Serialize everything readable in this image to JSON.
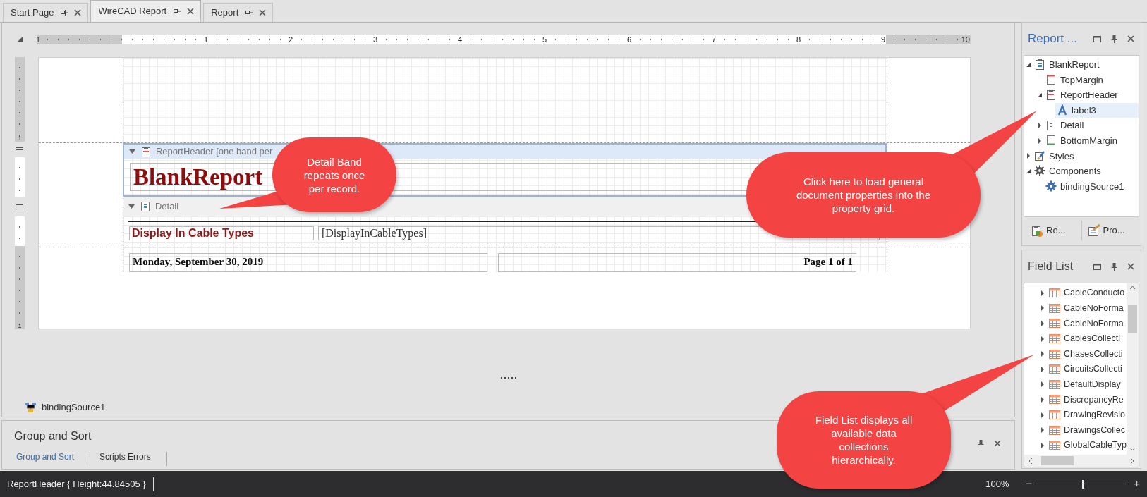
{
  "tabs": [
    {
      "label": "Start Page",
      "selected": false
    },
    {
      "label": "WireCAD Report",
      "selected": true
    },
    {
      "label": "Report",
      "selected": false
    }
  ],
  "ruler": {
    "start_label": "1",
    "segments": [
      {
        "margin": true
      },
      {
        "label": "1",
        "margin": false
      },
      {
        "label": "2",
        "margin": false
      },
      {
        "label": "3",
        "margin": false
      },
      {
        "label": "4",
        "margin": false
      },
      {
        "label": "5",
        "margin": false
      },
      {
        "label": "6",
        "margin": false
      },
      {
        "label": "7",
        "margin": false
      },
      {
        "label": "8",
        "margin": false
      },
      {
        "label": "9",
        "margin": false
      },
      {
        "label": "10",
        "margin": true
      }
    ]
  },
  "vertical_ruler": {
    "labels": [
      "1",
      "1"
    ]
  },
  "report": {
    "report_header": {
      "caption": "ReportHeader [one band per",
      "title": "BlankReport",
      "selected": true
    },
    "detail": {
      "caption": "Detail",
      "label": "Display In Cable Types",
      "field": "[DisplayInCableTypes]"
    },
    "bottom_margin": {
      "date": "Monday, September 30, 2019",
      "page": "Page 1 of 1"
    }
  },
  "component_tray": [
    {
      "label": "bindingSource1"
    }
  ],
  "group_sort": {
    "title": "Group and Sort",
    "tabs": [
      {
        "label": "Group and Sort",
        "selected": true
      },
      {
        "label": "Scripts Errors",
        "selected": false
      }
    ]
  },
  "report_explorer": {
    "title": "Report ...",
    "tree": [
      {
        "label": "BlankReport",
        "kind": "report",
        "expanded": true,
        "selected": false,
        "children": [
          {
            "label": "TopMargin",
            "kind": "topmargin",
            "selected": false
          },
          {
            "label": "ReportHeader",
            "kind": "header",
            "expanded": true,
            "selected": false,
            "children": [
              {
                "label": "label3",
                "kind": "label",
                "selected": true
              }
            ]
          },
          {
            "label": "Detail",
            "kind": "detail",
            "expanded": false,
            "selected": false
          },
          {
            "label": "BottomMargin",
            "kind": "bottommargin",
            "expanded": false,
            "selected": false
          }
        ]
      },
      {
        "label": "Styles",
        "kind": "styles",
        "expanded": false,
        "selected": false
      },
      {
        "label": "Components",
        "kind": "components",
        "expanded": true,
        "selected": false,
        "children": [
          {
            "label": "bindingSource1",
            "kind": "binding",
            "selected": false
          }
        ]
      }
    ],
    "buttons": [
      {
        "label": "Re...",
        "kind": "report"
      },
      {
        "label": "Pro...",
        "kind": "properties"
      }
    ]
  },
  "field_list": {
    "title": "Field List",
    "items": [
      {
        "label": "CableConducto",
        "expanded": false
      },
      {
        "label": "CableNoForma",
        "expanded": false
      },
      {
        "label": "CableNoForma",
        "expanded": false
      },
      {
        "label": "CablesCollecti",
        "expanded": false
      },
      {
        "label": "ChasesCollecti",
        "expanded": false
      },
      {
        "label": "CircuitsCollecti",
        "expanded": false
      },
      {
        "label": "DefaultDisplay",
        "expanded": false
      },
      {
        "label": "DiscrepancyRe",
        "expanded": false
      },
      {
        "label": "DrawingRevisio",
        "expanded": false
      },
      {
        "label": "DrawingsCollec",
        "expanded": false
      },
      {
        "label": "GlobalCableTyp",
        "expanded": false
      }
    ]
  },
  "status_bar": {
    "text": "ReportHeader { Height:44.84505 }",
    "zoom": "100%",
    "zoom_out": "−",
    "zoom_in": "+",
    "zoom_slider": {
      "level": 0.5
    }
  },
  "callouts": [
    {
      "text": "Detail Band repeats once per record."
    },
    {
      "text": "Click here to load general document properties into the property grid."
    },
    {
      "text": "Field List displays all available data collections hierarchically."
    }
  ]
}
